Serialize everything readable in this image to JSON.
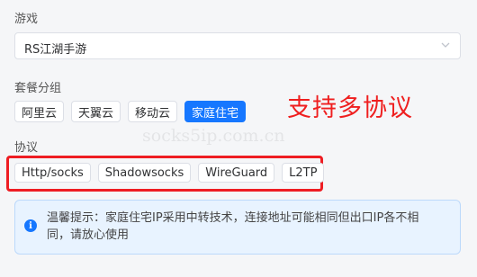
{
  "game": {
    "label": "游戏",
    "selected": "RS江湖手游"
  },
  "plan_group": {
    "label": "套餐分组",
    "options": [
      "阿里云",
      "天翼云",
      "移动云",
      "家庭住宅"
    ],
    "active_index": 3
  },
  "annotation": {
    "text": "支持多协议",
    "color": "#ef1f1f"
  },
  "watermark": "socks5ip.com.cn",
  "protocol": {
    "label": "协议",
    "options": [
      "Http/socks",
      "Shadowsocks",
      "WireGuard",
      "L2TP"
    ]
  },
  "notice": {
    "icon": "info-icon",
    "line1": "温馨提示：家庭住宅IP采用中转技术，连接地址可能相同但出口IP各不相",
    "line2": "同，请放心使用"
  },
  "colors": {
    "accent": "#1677ff",
    "highlight_box": "#ee1d23"
  }
}
